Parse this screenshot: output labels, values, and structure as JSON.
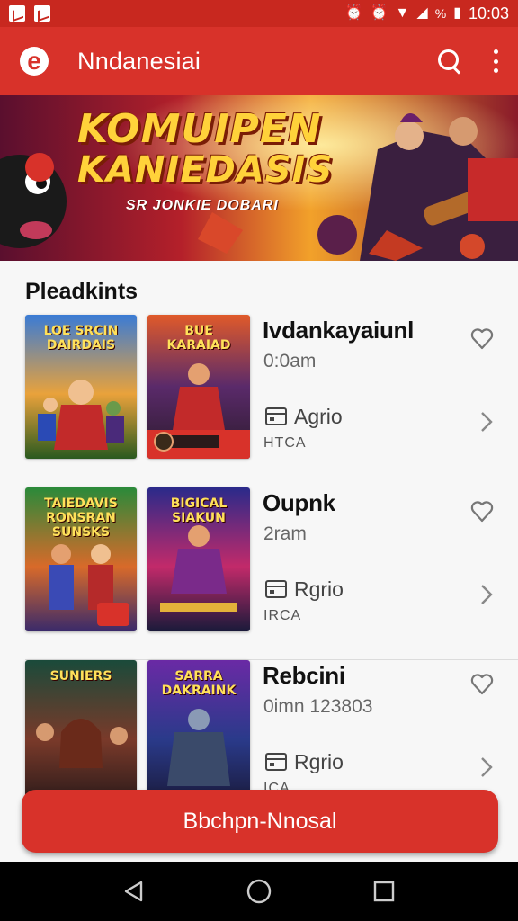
{
  "status_bar": {
    "time": "10:03",
    "battery_pct": "%"
  },
  "app_bar": {
    "title": "Nndanesiai",
    "logo_letter": "e"
  },
  "banner": {
    "title_line1": "KOMUIPEN",
    "title_line2": "KANIEDASIS",
    "subtitle": "SR JONKIE DOBARI"
  },
  "section": {
    "title": "Pleadkints"
  },
  "items": [
    {
      "name": "Ivdankayaiunl",
      "meta": "0:0am",
      "ticket": "Agrio",
      "code": "HTCA",
      "cover_a": "LOE SRCIN DAIRDAIS",
      "cover_b": "BUE KARAIAD"
    },
    {
      "name": "Oupnk",
      "meta": "2ram",
      "ticket": "Rgrio",
      "code": "IRCA",
      "cover_a": "TAIEDAVIS RONSRAN SUNSKS",
      "cover_b": "BIGICAL SIAKUN"
    },
    {
      "name": "Rebcini",
      "meta": "0imn 123803",
      "ticket": "Rgrio",
      "code": "ICA",
      "cover_a": "SUNIERS",
      "cover_b": "SARRA DAKRAINK"
    }
  ],
  "cta": {
    "label": "Bbchpn-Nnosal"
  },
  "colors": {
    "primary": "#d8322a",
    "status": "#c8281f"
  },
  "nav": {
    "back_icon": "triangle-back-icon",
    "home_icon": "circle-home-icon",
    "recents_icon": "square-recents-icon"
  }
}
